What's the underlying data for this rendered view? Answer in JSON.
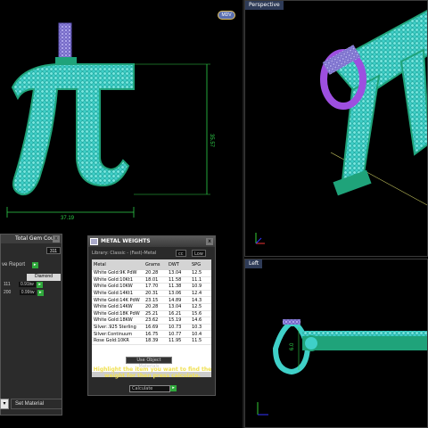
{
  "viewports": {
    "perspective_label": "Perspective",
    "left_label": "Left",
    "top_dims": {
      "width_dim": "37.19",
      "height_dim": "35.57"
    },
    "left_dim": "6.0",
    "logo_text": "MDV"
  },
  "gem_panel": {
    "header": "Total Gem Count",
    "total": "311",
    "report_label": "ve Report",
    "col_header": "Diamond",
    "rows": [
      {
        "qty": "111",
        "weight": "0.91tw"
      },
      {
        "qty": "200",
        "weight": "0.99tw"
      }
    ]
  },
  "metal_panel": {
    "title": "METAL WEIGHTS",
    "library": "Library: Classic - (Fast)-Metal",
    "ctrl_a": "cc",
    "ctrl_b": "Low",
    "columns": [
      "Metal",
      "Grams",
      "DWT",
      "SPG"
    ],
    "rows": [
      [
        "White Gold:9K PdW",
        "20.28",
        "13.04",
        "12.5"
      ],
      [
        "White Gold:10Kt1",
        "18.01",
        "11.58",
        "11.1"
      ],
      [
        "White Gold:10KW",
        "17.70",
        "11.38",
        "10.9"
      ],
      [
        "White Gold:14Kt1",
        "20.31",
        "13.06",
        "12.4"
      ],
      [
        "White Gold:14K PdW",
        "23.15",
        "14.89",
        "14.3"
      ],
      [
        "White Gold:14KW",
        "20.28",
        "13.04",
        "12.5"
      ],
      [
        "White Gold:18K PdW",
        "25.21",
        "16.21",
        "15.6"
      ],
      [
        "White Gold:18KW",
        "23.62",
        "15.19",
        "14.6"
      ],
      [
        "Silver:.925 Sterling",
        "16.69",
        "10.73",
        "10.3"
      ],
      [
        "Silver:Continuum",
        "16.75",
        "10.77",
        "10.4"
      ],
      [
        "Rose Gold:10KR",
        "18.39",
        "11.95",
        "11.5"
      ]
    ],
    "use_label": "Use Object Materials",
    "hint": "Highlight the item you want to find the weight for then press calculate.",
    "calc_label": "Calculate"
  },
  "bottom": {
    "set_material": "Set Material"
  }
}
